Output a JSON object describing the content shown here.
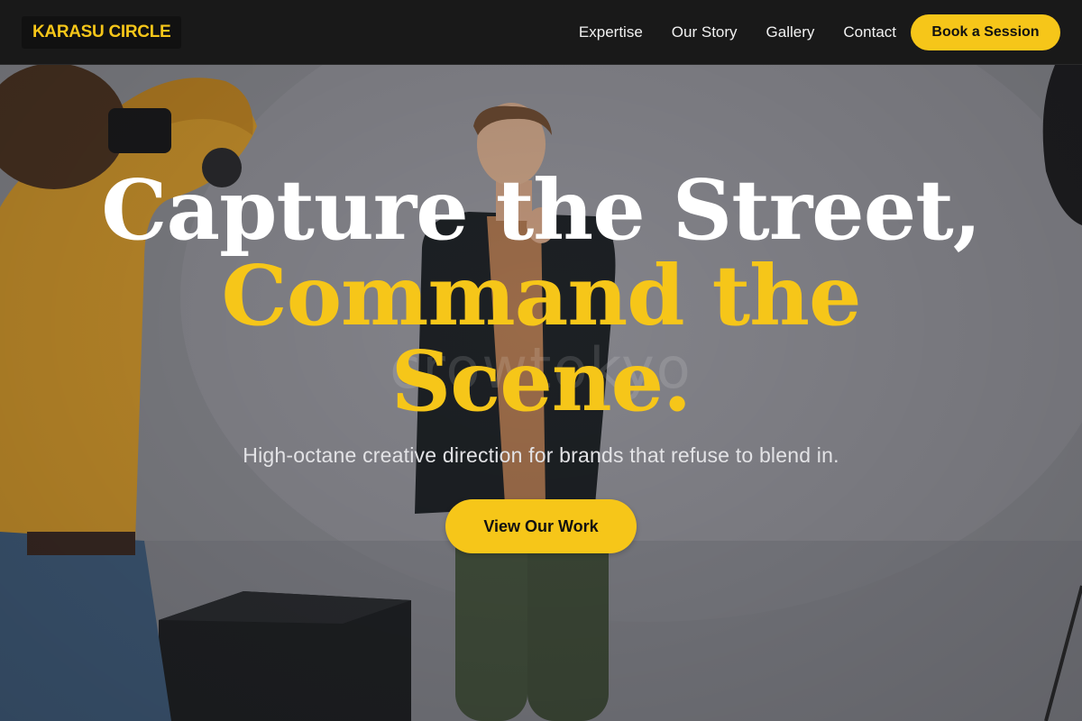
{
  "brand": {
    "logo_text": "KARASU CIRCLE"
  },
  "nav": {
    "links": [
      {
        "label": "Expertise"
      },
      {
        "label": "Our Story"
      },
      {
        "label": "Gallery"
      },
      {
        "label": "Contact"
      }
    ],
    "cta_label": "Book a Session"
  },
  "hero": {
    "headline_line1": "Capture the Street,",
    "headline_line2": "Command the",
    "headline_line3": "Scene.",
    "subheadline": "High-octane creative direction for brands that refuse to blend in.",
    "cta_label": "View Our Work",
    "watermark": "crowtokyo",
    "image": "studio photo shoot: photographer in mustard sweater photographing a model in a dark blazer"
  },
  "colors": {
    "accent": "#f6c619",
    "nav_bg": "#191919",
    "headline_white": "#ffffff"
  }
}
